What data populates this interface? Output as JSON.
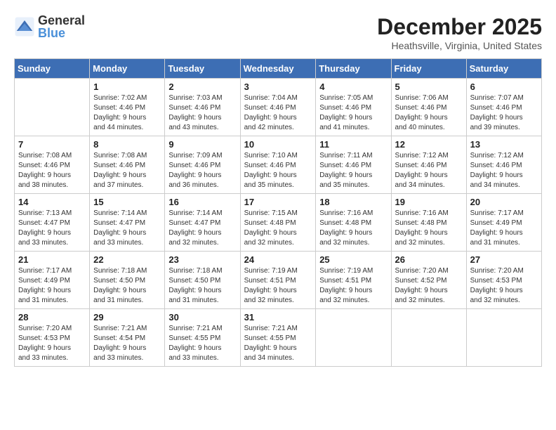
{
  "logo": {
    "general": "General",
    "blue": "Blue"
  },
  "header": {
    "month_year": "December 2025",
    "location": "Heathsville, Virginia, United States"
  },
  "days_of_week": [
    "Sunday",
    "Monday",
    "Tuesday",
    "Wednesday",
    "Thursday",
    "Friday",
    "Saturday"
  ],
  "weeks": [
    [
      {
        "num": "",
        "info": ""
      },
      {
        "num": "1",
        "info": "Sunrise: 7:02 AM\nSunset: 4:46 PM\nDaylight: 9 hours\nand 44 minutes."
      },
      {
        "num": "2",
        "info": "Sunrise: 7:03 AM\nSunset: 4:46 PM\nDaylight: 9 hours\nand 43 minutes."
      },
      {
        "num": "3",
        "info": "Sunrise: 7:04 AM\nSunset: 4:46 PM\nDaylight: 9 hours\nand 42 minutes."
      },
      {
        "num": "4",
        "info": "Sunrise: 7:05 AM\nSunset: 4:46 PM\nDaylight: 9 hours\nand 41 minutes."
      },
      {
        "num": "5",
        "info": "Sunrise: 7:06 AM\nSunset: 4:46 PM\nDaylight: 9 hours\nand 40 minutes."
      },
      {
        "num": "6",
        "info": "Sunrise: 7:07 AM\nSunset: 4:46 PM\nDaylight: 9 hours\nand 39 minutes."
      }
    ],
    [
      {
        "num": "7",
        "info": "Sunrise: 7:08 AM\nSunset: 4:46 PM\nDaylight: 9 hours\nand 38 minutes."
      },
      {
        "num": "8",
        "info": "Sunrise: 7:08 AM\nSunset: 4:46 PM\nDaylight: 9 hours\nand 37 minutes."
      },
      {
        "num": "9",
        "info": "Sunrise: 7:09 AM\nSunset: 4:46 PM\nDaylight: 9 hours\nand 36 minutes."
      },
      {
        "num": "10",
        "info": "Sunrise: 7:10 AM\nSunset: 4:46 PM\nDaylight: 9 hours\nand 35 minutes."
      },
      {
        "num": "11",
        "info": "Sunrise: 7:11 AM\nSunset: 4:46 PM\nDaylight: 9 hours\nand 35 minutes."
      },
      {
        "num": "12",
        "info": "Sunrise: 7:12 AM\nSunset: 4:46 PM\nDaylight: 9 hours\nand 34 minutes."
      },
      {
        "num": "13",
        "info": "Sunrise: 7:12 AM\nSunset: 4:46 PM\nDaylight: 9 hours\nand 34 minutes."
      }
    ],
    [
      {
        "num": "14",
        "info": "Sunrise: 7:13 AM\nSunset: 4:47 PM\nDaylight: 9 hours\nand 33 minutes."
      },
      {
        "num": "15",
        "info": "Sunrise: 7:14 AM\nSunset: 4:47 PM\nDaylight: 9 hours\nand 33 minutes."
      },
      {
        "num": "16",
        "info": "Sunrise: 7:14 AM\nSunset: 4:47 PM\nDaylight: 9 hours\nand 32 minutes."
      },
      {
        "num": "17",
        "info": "Sunrise: 7:15 AM\nSunset: 4:48 PM\nDaylight: 9 hours\nand 32 minutes."
      },
      {
        "num": "18",
        "info": "Sunrise: 7:16 AM\nSunset: 4:48 PM\nDaylight: 9 hours\nand 32 minutes."
      },
      {
        "num": "19",
        "info": "Sunrise: 7:16 AM\nSunset: 4:48 PM\nDaylight: 9 hours\nand 32 minutes."
      },
      {
        "num": "20",
        "info": "Sunrise: 7:17 AM\nSunset: 4:49 PM\nDaylight: 9 hours\nand 31 minutes."
      }
    ],
    [
      {
        "num": "21",
        "info": "Sunrise: 7:17 AM\nSunset: 4:49 PM\nDaylight: 9 hours\nand 31 minutes."
      },
      {
        "num": "22",
        "info": "Sunrise: 7:18 AM\nSunset: 4:50 PM\nDaylight: 9 hours\nand 31 minutes."
      },
      {
        "num": "23",
        "info": "Sunrise: 7:18 AM\nSunset: 4:50 PM\nDaylight: 9 hours\nand 31 minutes."
      },
      {
        "num": "24",
        "info": "Sunrise: 7:19 AM\nSunset: 4:51 PM\nDaylight: 9 hours\nand 32 minutes."
      },
      {
        "num": "25",
        "info": "Sunrise: 7:19 AM\nSunset: 4:51 PM\nDaylight: 9 hours\nand 32 minutes."
      },
      {
        "num": "26",
        "info": "Sunrise: 7:20 AM\nSunset: 4:52 PM\nDaylight: 9 hours\nand 32 minutes."
      },
      {
        "num": "27",
        "info": "Sunrise: 7:20 AM\nSunset: 4:53 PM\nDaylight: 9 hours\nand 32 minutes."
      }
    ],
    [
      {
        "num": "28",
        "info": "Sunrise: 7:20 AM\nSunset: 4:53 PM\nDaylight: 9 hours\nand 33 minutes."
      },
      {
        "num": "29",
        "info": "Sunrise: 7:21 AM\nSunset: 4:54 PM\nDaylight: 9 hours\nand 33 minutes."
      },
      {
        "num": "30",
        "info": "Sunrise: 7:21 AM\nSunset: 4:55 PM\nDaylight: 9 hours\nand 33 minutes."
      },
      {
        "num": "31",
        "info": "Sunrise: 7:21 AM\nSunset: 4:55 PM\nDaylight: 9 hours\nand 34 minutes."
      },
      {
        "num": "",
        "info": ""
      },
      {
        "num": "",
        "info": ""
      },
      {
        "num": "",
        "info": ""
      }
    ]
  ]
}
